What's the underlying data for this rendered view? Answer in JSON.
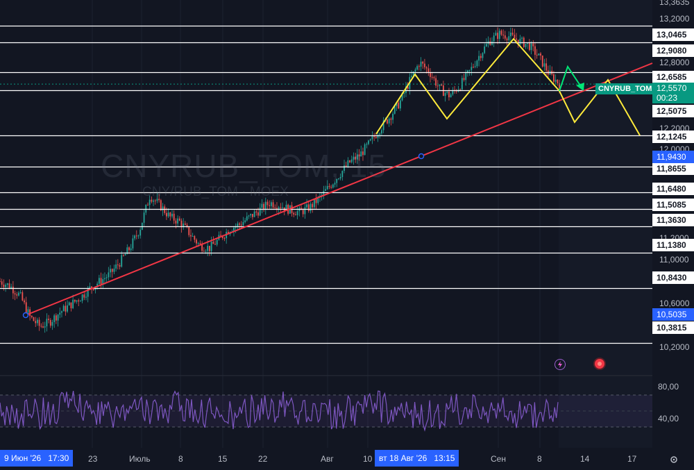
{
  "watermark": {
    "symbol": "CNYRUB_TOM, 15",
    "subtitle": "CNY/RUB_TOM · MOEX"
  },
  "price_scale": {
    "ticks": [
      "13,3635",
      "13,2000",
      "12,8000",
      "12,2000",
      "12,0000",
      "11,2000",
      "11,0000",
      "10,6000",
      "10,2000"
    ],
    "levels": [
      "13,0465",
      "12,9080",
      "12,6585",
      "12,5075",
      "12,1245",
      "11,8655",
      "11,6480",
      "11,5085",
      "11,3630",
      "11,1380",
      "10,8430",
      "10,3815"
    ],
    "marked": [
      "11,9430",
      "10,5035"
    ],
    "current": {
      "symbol": "CNYRUB_TOM",
      "price": "12,5570",
      "countdown": "00:23"
    }
  },
  "time_axis": {
    "labels": [
      "23",
      "Июль",
      "8",
      "15",
      "22",
      "Авг",
      "10",
      "Сен",
      "8",
      "14",
      "17"
    ],
    "start_box": {
      "date": "9 Июн '26",
      "time": "17:30"
    },
    "crosshair_box": {
      "date": "вт 18 Авг '26",
      "time": "13:15"
    }
  },
  "oscillator": {
    "labels": [
      "80,00",
      "40,00"
    ]
  },
  "icons": {
    "left": "lightning-icon",
    "right": "alert-dot-icon",
    "axis": "settings-icon"
  },
  "colors": {
    "background": "#121622",
    "candle_up": "#26a69a",
    "candle_down": "#ef5350",
    "level_lines": "#ffffff",
    "trendline": "#f23645",
    "pattern": "#ffeb3b",
    "arrow": "#00e676",
    "oscillator": "#7e57c2",
    "current_price": "#089981",
    "marker": "#2962ff"
  },
  "chart_data": {
    "type": "line",
    "series": [
      {
        "values": [
          10.9,
          10.86,
          10.78,
          10.6,
          10.52,
          10.56,
          10.64,
          10.7,
          10.76,
          10.84,
          10.9,
          10.96,
          11.06,
          11.18,
          11.34,
          11.62,
          11.54,
          11.44,
          11.4,
          11.3,
          11.2,
          11.18,
          11.26,
          11.34,
          11.38,
          11.44,
          11.5,
          11.56,
          11.54,
          11.5,
          11.48,
          11.52,
          11.6,
          11.7,
          11.8,
          11.9,
          11.96,
          12.06,
          12.18,
          12.28,
          12.4,
          12.58,
          12.74,
          12.66,
          12.52,
          12.46,
          12.54,
          12.66,
          12.8,
          12.92,
          12.98,
          12.96,
          12.92,
          12.88,
          12.78,
          12.64,
          12.56
        ]
      }
    ],
    "levels": [
      13.0465,
      12.908,
      12.6585,
      12.5075,
      12.1245,
      11.8655,
      11.648,
      11.5085,
      11.363,
      11.138,
      10.843,
      10.3815
    ],
    "last_price": 12.557,
    "ylim": [
      10.2,
      13.3635
    ]
  }
}
